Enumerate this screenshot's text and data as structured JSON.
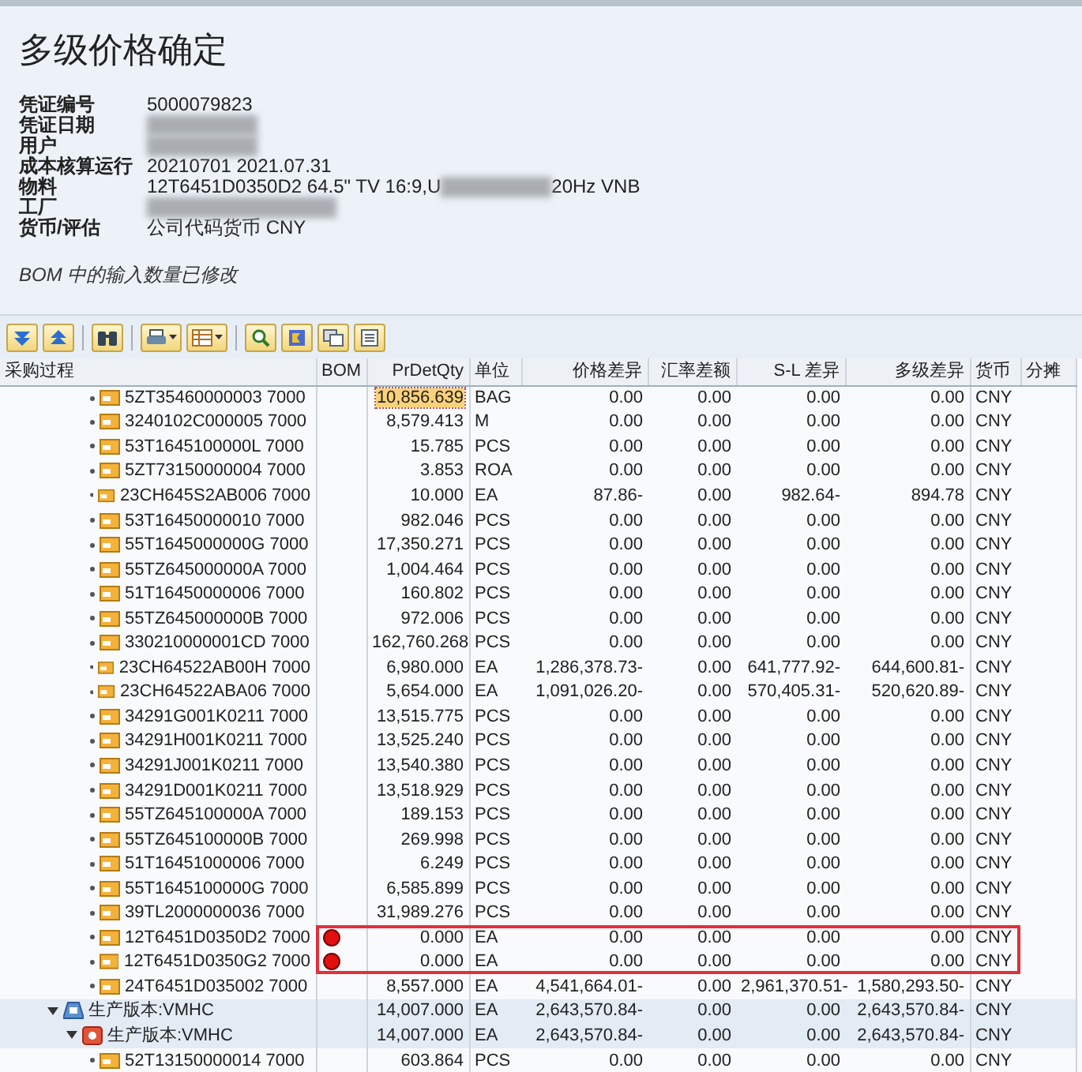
{
  "title": "多级价格确定",
  "fields": [
    {
      "label": "凭证编号",
      "value": "5000079823",
      "redacted": false
    },
    {
      "label": "凭证日期",
      "redacted": true
    },
    {
      "label": "用户",
      "redacted": true
    },
    {
      "label": "成本核算运行",
      "value": "20210701 2021.07.31",
      "redacted": false
    },
    {
      "label": "物料",
      "value": "12T6451D0350D2 64.5\" TV 16:9,U",
      "value_end": "20Hz VNB",
      "redacted": true
    },
    {
      "label": "工厂",
      "redacted": true
    },
    {
      "label": "货币/评估",
      "value": "公司代码货币 CNY",
      "redacted": false
    }
  ],
  "message": "BOM 中的输入数量已修改",
  "columns": [
    "采购过程",
    "BOM",
    "PrDetQty",
    "单位",
    "价格差异",
    "汇率差额",
    "S-L 差异",
    "多级差异",
    "货币",
    "分摊"
  ],
  "rows": [
    {
      "kind": "material",
      "label": "5ZT35460000003 7000",
      "bom_error": false,
      "qty": "10,856.639",
      "unit": "BAG",
      "price_diff": "0.00",
      "fx_diff": "0.00",
      "sl_diff": "0.00",
      "ml_diff": "0.00",
      "currency": "CNY",
      "focused": true,
      "highlighted": false
    },
    {
      "kind": "material",
      "label": "3240102C000005 7000",
      "bom_error": false,
      "qty": "8,579.413",
      "unit": "M",
      "price_diff": "0.00",
      "fx_diff": "0.00",
      "sl_diff": "0.00",
      "ml_diff": "0.00",
      "currency": "CNY",
      "focused": false,
      "highlighted": false
    },
    {
      "kind": "material",
      "label": "53T1645100000L 7000",
      "bom_error": false,
      "qty": "15.785",
      "unit": "PCS",
      "price_diff": "0.00",
      "fx_diff": "0.00",
      "sl_diff": "0.00",
      "ml_diff": "0.00",
      "currency": "CNY",
      "focused": false,
      "highlighted": false
    },
    {
      "kind": "material",
      "label": "5ZT73150000004 7000",
      "bom_error": false,
      "qty": "3.853",
      "unit": "ROA",
      "price_diff": "0.00",
      "fx_diff": "0.00",
      "sl_diff": "0.00",
      "ml_diff": "0.00",
      "currency": "CNY",
      "focused": false,
      "highlighted": false
    },
    {
      "kind": "material",
      "label": "23CH645S2AB006 7000",
      "bom_error": false,
      "qty": "10.000",
      "unit": "EA",
      "price_diff": "87.86-",
      "fx_diff": "0.00",
      "sl_diff": "982.64-",
      "ml_diff": "894.78",
      "currency": "CNY",
      "focused": false,
      "highlighted": false
    },
    {
      "kind": "material",
      "label": "53T16450000010 7000",
      "bom_error": false,
      "qty": "982.046",
      "unit": "PCS",
      "price_diff": "0.00",
      "fx_diff": "0.00",
      "sl_diff": "0.00",
      "ml_diff": "0.00",
      "currency": "CNY",
      "focused": false,
      "highlighted": false
    },
    {
      "kind": "material",
      "label": "55T1645000000G 7000",
      "bom_error": false,
      "qty": "17,350.271",
      "unit": "PCS",
      "price_diff": "0.00",
      "fx_diff": "0.00",
      "sl_diff": "0.00",
      "ml_diff": "0.00",
      "currency": "CNY",
      "focused": false,
      "highlighted": false
    },
    {
      "kind": "material",
      "label": "55TZ645000000A 7000",
      "bom_error": false,
      "qty": "1,004.464",
      "unit": "PCS",
      "price_diff": "0.00",
      "fx_diff": "0.00",
      "sl_diff": "0.00",
      "ml_diff": "0.00",
      "currency": "CNY",
      "focused": false,
      "highlighted": false
    },
    {
      "kind": "material",
      "label": "51T16450000006 7000",
      "bom_error": false,
      "qty": "160.802",
      "unit": "PCS",
      "price_diff": "0.00",
      "fx_diff": "0.00",
      "sl_diff": "0.00",
      "ml_diff": "0.00",
      "currency": "CNY",
      "focused": false,
      "highlighted": false
    },
    {
      "kind": "material",
      "label": "55TZ645000000B 7000",
      "bom_error": false,
      "qty": "972.006",
      "unit": "PCS",
      "price_diff": "0.00",
      "fx_diff": "0.00",
      "sl_diff": "0.00",
      "ml_diff": "0.00",
      "currency": "CNY",
      "focused": false,
      "highlighted": false
    },
    {
      "kind": "material",
      "label": "330210000001CD 7000",
      "bom_error": false,
      "qty": "162,760.268",
      "unit": "PCS",
      "price_diff": "0.00",
      "fx_diff": "0.00",
      "sl_diff": "0.00",
      "ml_diff": "0.00",
      "currency": "CNY",
      "focused": false,
      "highlighted": false
    },
    {
      "kind": "material",
      "label": "23CH64522AB00H 7000",
      "bom_error": false,
      "qty": "6,980.000",
      "unit": "EA",
      "price_diff": "1,286,378.73-",
      "fx_diff": "0.00",
      "sl_diff": "641,777.92-",
      "ml_diff": "644,600.81-",
      "currency": "CNY",
      "focused": false,
      "highlighted": false
    },
    {
      "kind": "material",
      "label": "23CH64522ABA06 7000",
      "bom_error": false,
      "qty": "5,654.000",
      "unit": "EA",
      "price_diff": "1,091,026.20-",
      "fx_diff": "0.00",
      "sl_diff": "570,405.31-",
      "ml_diff": "520,620.89-",
      "currency": "CNY",
      "focused": false,
      "highlighted": false
    },
    {
      "kind": "material",
      "label": "34291G001K0211 7000",
      "bom_error": false,
      "qty": "13,515.775",
      "unit": "PCS",
      "price_diff": "0.00",
      "fx_diff": "0.00",
      "sl_diff": "0.00",
      "ml_diff": "0.00",
      "currency": "CNY",
      "focused": false,
      "highlighted": false
    },
    {
      "kind": "material",
      "label": "34291H001K0211 7000",
      "bom_error": false,
      "qty": "13,525.240",
      "unit": "PCS",
      "price_diff": "0.00",
      "fx_diff": "0.00",
      "sl_diff": "0.00",
      "ml_diff": "0.00",
      "currency": "CNY",
      "focused": false,
      "highlighted": false
    },
    {
      "kind": "material",
      "label": "34291J001K0211 7000",
      "bom_error": false,
      "qty": "13,540.380",
      "unit": "PCS",
      "price_diff": "0.00",
      "fx_diff": "0.00",
      "sl_diff": "0.00",
      "ml_diff": "0.00",
      "currency": "CNY",
      "focused": false,
      "highlighted": false
    },
    {
      "kind": "material",
      "label": "34291D001K0211 7000",
      "bom_error": false,
      "qty": "13,518.929",
      "unit": "PCS",
      "price_diff": "0.00",
      "fx_diff": "0.00",
      "sl_diff": "0.00",
      "ml_diff": "0.00",
      "currency": "CNY",
      "focused": false,
      "highlighted": false
    },
    {
      "kind": "material",
      "label": "55TZ645100000A 7000",
      "bom_error": false,
      "qty": "189.153",
      "unit": "PCS",
      "price_diff": "0.00",
      "fx_diff": "0.00",
      "sl_diff": "0.00",
      "ml_diff": "0.00",
      "currency": "CNY",
      "focused": false,
      "highlighted": false
    },
    {
      "kind": "material",
      "label": "55TZ645100000B 7000",
      "bom_error": false,
      "qty": "269.998",
      "unit": "PCS",
      "price_diff": "0.00",
      "fx_diff": "0.00",
      "sl_diff": "0.00",
      "ml_diff": "0.00",
      "currency": "CNY",
      "focused": false,
      "highlighted": false
    },
    {
      "kind": "material",
      "label": "51T16451000006 7000",
      "bom_error": false,
      "qty": "6.249",
      "unit": "PCS",
      "price_diff": "0.00",
      "fx_diff": "0.00",
      "sl_diff": "0.00",
      "ml_diff": "0.00",
      "currency": "CNY",
      "focused": false,
      "highlighted": false
    },
    {
      "kind": "material",
      "label": "55T1645100000G 7000",
      "bom_error": false,
      "qty": "6,585.899",
      "unit": "PCS",
      "price_diff": "0.00",
      "fx_diff": "0.00",
      "sl_diff": "0.00",
      "ml_diff": "0.00",
      "currency": "CNY",
      "focused": false,
      "highlighted": false
    },
    {
      "kind": "material",
      "label": "39TL2000000036 7000",
      "bom_error": false,
      "qty": "31,989.276",
      "unit": "PCS",
      "price_diff": "0.00",
      "fx_diff": "0.00",
      "sl_diff": "0.00",
      "ml_diff": "0.00",
      "currency": "CNY",
      "focused": false,
      "highlighted": false
    },
    {
      "kind": "material",
      "label": "12T6451D0350D2 7000",
      "bom_error": true,
      "qty": "0.000",
      "unit": "EA",
      "price_diff": "0.00",
      "fx_diff": "0.00",
      "sl_diff": "0.00",
      "ml_diff": "0.00",
      "currency": "CNY",
      "focused": false,
      "highlighted": true
    },
    {
      "kind": "material",
      "label": "12T6451D0350G2 7000",
      "bom_error": true,
      "qty": "0.000",
      "unit": "EA",
      "price_diff": "0.00",
      "fx_diff": "0.00",
      "sl_diff": "0.00",
      "ml_diff": "0.00",
      "currency": "CNY",
      "focused": false,
      "highlighted": true
    },
    {
      "kind": "material",
      "label": "24T6451D035002 7000",
      "bom_error": false,
      "qty": "8,557.000",
      "unit": "EA",
      "price_diff": "4,541,664.01-",
      "fx_diff": "0.00",
      "sl_diff": "2,961,370.51-",
      "ml_diff": "1,580,293.50-",
      "currency": "CNY",
      "focused": false,
      "highlighted": false
    },
    {
      "kind": "group",
      "label": "生产版本:VMHC",
      "expanded": true,
      "bom_error": false,
      "qty": "14,007.000",
      "unit": "EA",
      "price_diff": "2,643,570.84-",
      "fx_diff": "0.00",
      "sl_diff": "0.00",
      "ml_diff": "2,643,570.84-",
      "currency": "CNY",
      "focused": false,
      "highlighted": false,
      "children": [
        {
          "kind": "process",
          "label": "生产版本:VMHC",
          "expanded": true,
          "bom_error": false,
          "qty": "14,007.000",
          "unit": "EA",
          "price_diff": "2,643,570.84-",
          "fx_diff": "0.00",
          "sl_diff": "0.00",
          "ml_diff": "2,643,570.84-",
          "currency": "CNY",
          "focused": false,
          "highlighted": false,
          "children": [
            {
              "kind": "material",
              "label": "52T13150000014 7000",
              "bom_error": false,
              "qty": "603.864",
              "unit": "PCS",
              "price_diff": "0.00",
              "fx_diff": "0.00",
              "sl_diff": "0.00",
              "ml_diff": "0.00",
              "currency": "CNY",
              "focused": false,
              "highlighted": false
            }
          ]
        }
      ]
    }
  ]
}
